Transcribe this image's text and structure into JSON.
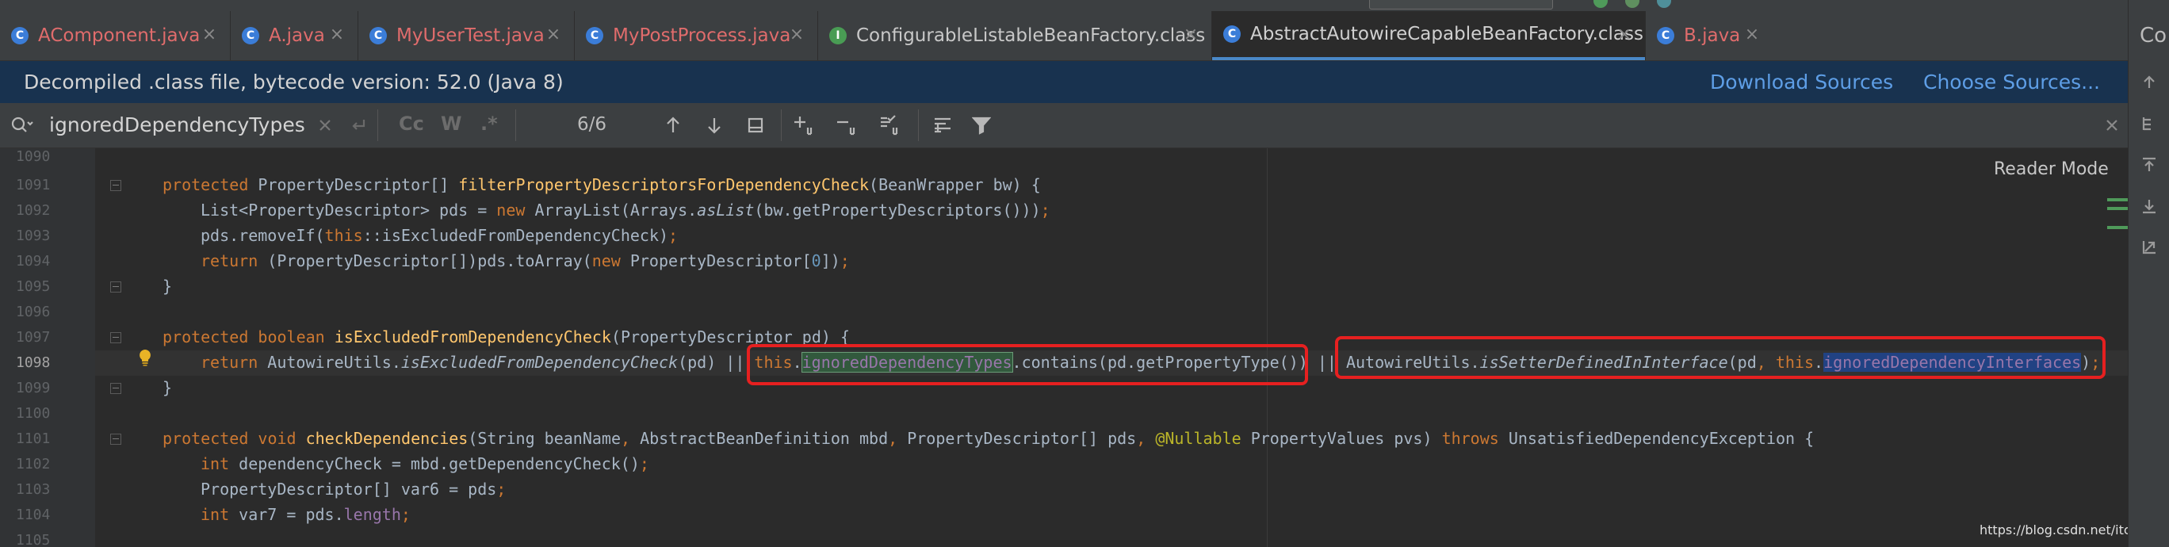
{
  "tabs": [
    {
      "label": "AComponent.java",
      "kind": "java",
      "icon_color": "#3b7dd8"
    },
    {
      "label": "A.java",
      "kind": "java",
      "icon_color": "#3b7dd8"
    },
    {
      "label": "MyUserTest.java",
      "kind": "java",
      "icon_color": "#3b7dd8"
    },
    {
      "label": "MyPostProcess.java",
      "kind": "java",
      "icon_color": "#3b7dd8"
    },
    {
      "label": "ConfigurableListableBeanFactory.class",
      "kind": "class",
      "icon_color": "#499c54"
    },
    {
      "label": "AbstractAutowireCapableBeanFactory.class",
      "kind": "class",
      "icon_color": "#3b7dd8",
      "active": true
    },
    {
      "label": "B.java",
      "kind": "java",
      "icon_color": "#3b7dd8"
    }
  ],
  "tab_close_glyph": "×",
  "banner": {
    "message": "Decompiled .class file, bytecode version: 52.0 (Java 8)",
    "download_sources": "Download Sources",
    "choose_sources": "Choose Sources..."
  },
  "find": {
    "query": "ignoredDependencyTypes",
    "match_count": "6/6",
    "opt_case": "Cc",
    "opt_words": "W",
    "opt_regex": ".*"
  },
  "right_panel": {
    "label": "Co"
  },
  "editor": {
    "reader_mode": "Reader Mode",
    "current_line": "1098",
    "line_numbers": [
      "1090",
      "1091",
      "1092",
      "1093",
      "1094",
      "1095",
      "1096",
      "1097",
      "1098",
      "1099",
      "1100",
      "1101",
      "1102",
      "1103",
      "1104",
      "1105"
    ],
    "lines": {
      "l1091": {
        "kw": "protected",
        "type": " PropertyDescriptor[] ",
        "name": "filterPropertyDescriptorsForDependencyCheck",
        "rest": "(BeanWrapper bw) {"
      },
      "l1092": {
        "a": "List<PropertyDescriptor> pds = ",
        "kw": "new",
        "b": " ArrayList(Arrays.",
        "it": "asList",
        "c": "(bw.getPropertyDescriptors()))",
        "semi": ";"
      },
      "l1093": {
        "a": "pds.removeIf(",
        "kw": "this",
        "b": "::isExcludedFromDependencyCheck)",
        "semi": ";"
      },
      "l1094": {
        "kw": "return",
        "a": " (PropertyDescriptor[])pds.toArray(",
        "kw2": "new",
        "b": " PropertyDescriptor[",
        "num": "0",
        "c": "])",
        "semi": ";"
      },
      "l1095": {
        "a": "}"
      },
      "l1097": {
        "kw": "protected boolean",
        "sp": " ",
        "name": "isExcludedFromDependencyCheck",
        "rest": "(PropertyDescriptor pd) {"
      },
      "l1098": {
        "kw": "return",
        "a": " AutowireUtils.",
        "it": "isExcludedFromDependencyCheck",
        "b": "(pd) || ",
        "this1": "this",
        "dot1": ".",
        "f1": "ignoredDependencyTypes",
        "c": ".contains(pd.getPropertyType()) || AutowireUtils.",
        "it2": "isSetterDefinedInInterface",
        "d": "(pd",
        "comma": ",",
        "sp": " ",
        "this2": "this",
        "dot2": ".",
        "f2": "ignoredDependencyInterfaces",
        "e": ")",
        "semi": ";"
      },
      "l1099": {
        "a": "}"
      },
      "l1101": {
        "kw": "protected void",
        "sp": " ",
        "name": "checkDependencies",
        "a": "(String beanName",
        "c1": ",",
        "b": " AbstractBeanDefinition mbd",
        "c2": ",",
        "c": " PropertyDescriptor[] pds",
        "c3": ",",
        "sp2": " ",
        "ann": "@Nullable",
        "d": " PropertyValues pvs) ",
        "kw2": "throws",
        "e": " UnsatisfiedDependencyException {"
      },
      "l1102": {
        "kw": "int",
        "a": " dependencyCheck = mbd.getDependencyCheck()",
        "semi": ";"
      },
      "l1103": {
        "a": "PropertyDescriptor[] var6 = pds",
        "semi": ";"
      },
      "l1104": {
        "kw": "int",
        "a": " var7 = pds.",
        "fld": "length",
        "semi": ";"
      }
    }
  },
  "watermark": "https://blog.csdn.net/itchenguang",
  "colors": {
    "highlight_box": "#e62020",
    "accent": "#4a88c7",
    "banner_bg": "#18324f"
  }
}
